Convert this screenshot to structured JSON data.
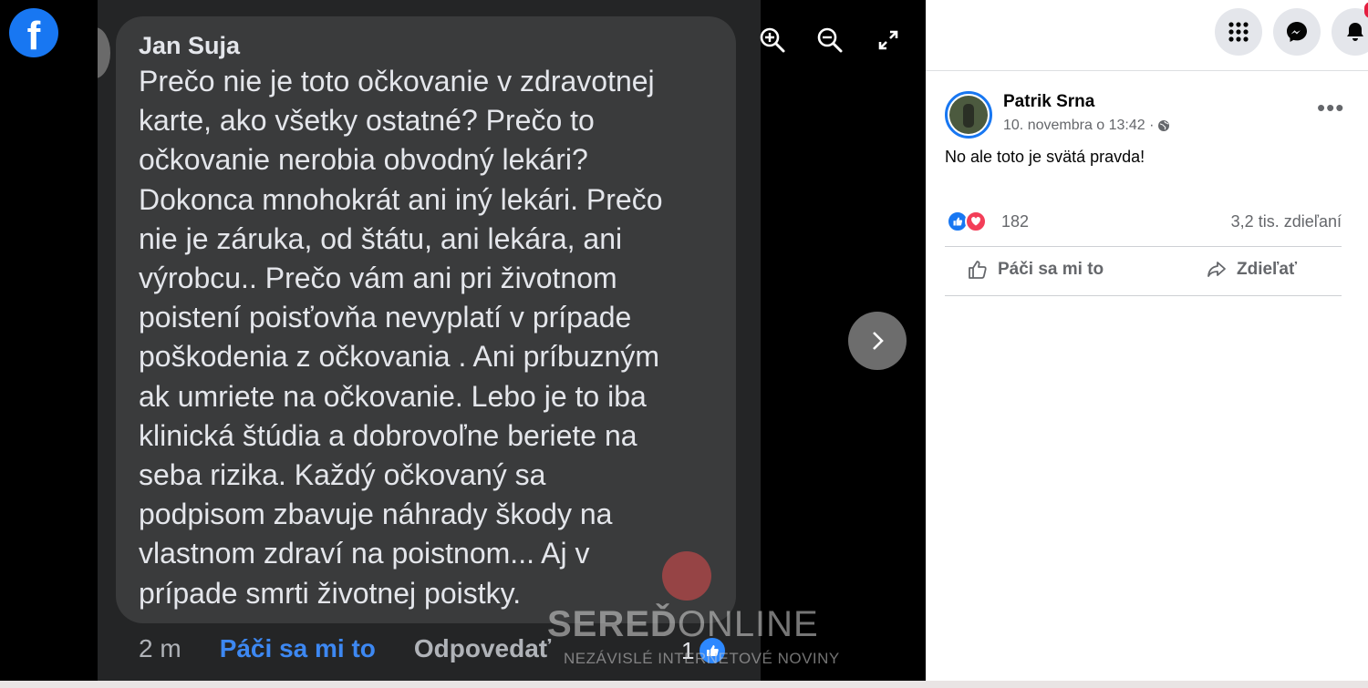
{
  "viewer": {
    "brand_icon": "facebook-logo",
    "comment": {
      "author": "Jan Suja",
      "lines": [
        "Prečo nie je toto očkovanie v zdravotnej",
        "karte, ako všetky ostatné? Prečo to",
        "očkovanie nerobia obvodný lekári?",
        "Dokonca mnohokrát ani iný lekári. Prečo",
        "nie je záruka, od štátu, ani lekára, ani",
        "výrobcu.. Prečo vám ani pri životnom",
        "poistení poisťovňa nevyplatí v prípade",
        "poškodenia z očkovania . Ani príbuzným",
        "ak umriete na očkovanie. Lebo je to iba",
        "klinická štúdia a dobrovoľne beriete na",
        "seba rizika. Každý očkovaný sa",
        "podpisom  zbavuje náhrady škody na",
        "vlastnom zdraví na poistnom... Aj v",
        "prípade smrti životnej poistky."
      ],
      "time": "2 m",
      "like_label": "Páči sa mi to",
      "reply_label": "Odpovedať",
      "reaction_count": "1"
    },
    "tools": {
      "zoom_in": "zoom-in-icon",
      "zoom_out": "zoom-out-icon",
      "fullscreen": "fullscreen-icon",
      "next": "chevron-right-icon"
    },
    "watermark": {
      "title_bold": "SEREĎ",
      "title_light": "ONLINE",
      "subtitle": "NEZÁVISLÉ INTERNETOVÉ NOVINY"
    }
  },
  "panel": {
    "topbar_icons": [
      "menu-grid-icon",
      "messenger-icon",
      "bell-icon"
    ],
    "post": {
      "author": "Patrik Srna",
      "date": "10. novembra o 13:42 ·",
      "privacy_icon": "globe-icon",
      "text": "No ale toto je svätá pravda!",
      "reaction_count": "182",
      "shares": "3,2 tis. zdieľaní",
      "like_label": "Páči sa mi to",
      "share_label": "Zdieľať"
    }
  },
  "colors": {
    "facebook_blue": "#1877f2",
    "comment_bubble": "#3a3b3c",
    "photo_bg": "#242526",
    "love_red": "#f33e58"
  }
}
